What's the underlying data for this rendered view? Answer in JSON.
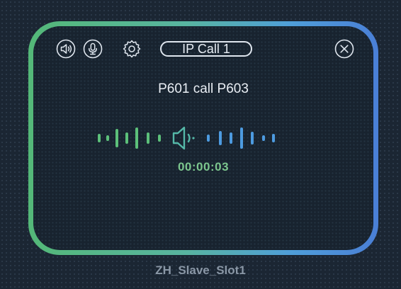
{
  "call_panel": {
    "badge_label": "IP Call 1",
    "title": "P601 call P603",
    "timer": "00:00:03"
  },
  "toolbar": {
    "icons": [
      "volume-icon",
      "microphone-icon",
      "settings-icon"
    ],
    "close_icon": "close-icon"
  },
  "device": {
    "slot_label": "ZH_Slave_Slot1"
  },
  "colors": {
    "frame_left": "#54b878",
    "frame_right": "#4a7fd6",
    "wave_left": "#5cc07a",
    "wave_right": "#4d9be0",
    "timer": "#7cc68e",
    "panel_bg": "#18232f"
  }
}
